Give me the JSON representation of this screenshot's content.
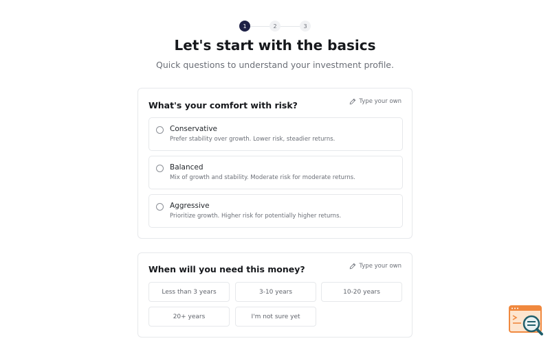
{
  "stepper": {
    "steps": [
      "1",
      "2",
      "3"
    ],
    "active_index": 0
  },
  "page": {
    "title": "Let's start with the basics",
    "subtitle": "Quick questions to understand your investment profile."
  },
  "risk_card": {
    "title": "What's your comfort with risk?",
    "type_own_label": "Type your own",
    "options": [
      {
        "label": "Conservative",
        "description": "Prefer stability over growth. Lower risk, steadier returns."
      },
      {
        "label": "Balanced",
        "description": "Mix of growth and stability. Moderate risk for moderate returns."
      },
      {
        "label": "Aggressive",
        "description": "Prioritize growth. Higher risk for potentially higher returns."
      }
    ]
  },
  "time_card": {
    "title": "When will you need this money?",
    "type_own_label": "Type your own",
    "options": [
      "Less than 3 years",
      "3-10 years",
      "10-20 years",
      "20+ years",
      "I'm not sure yet"
    ]
  },
  "colors": {
    "active_step": "#1e2146",
    "border": "#e6e8eb",
    "logo_orange": "#f0883e",
    "logo_teal": "#1f5e6b"
  }
}
